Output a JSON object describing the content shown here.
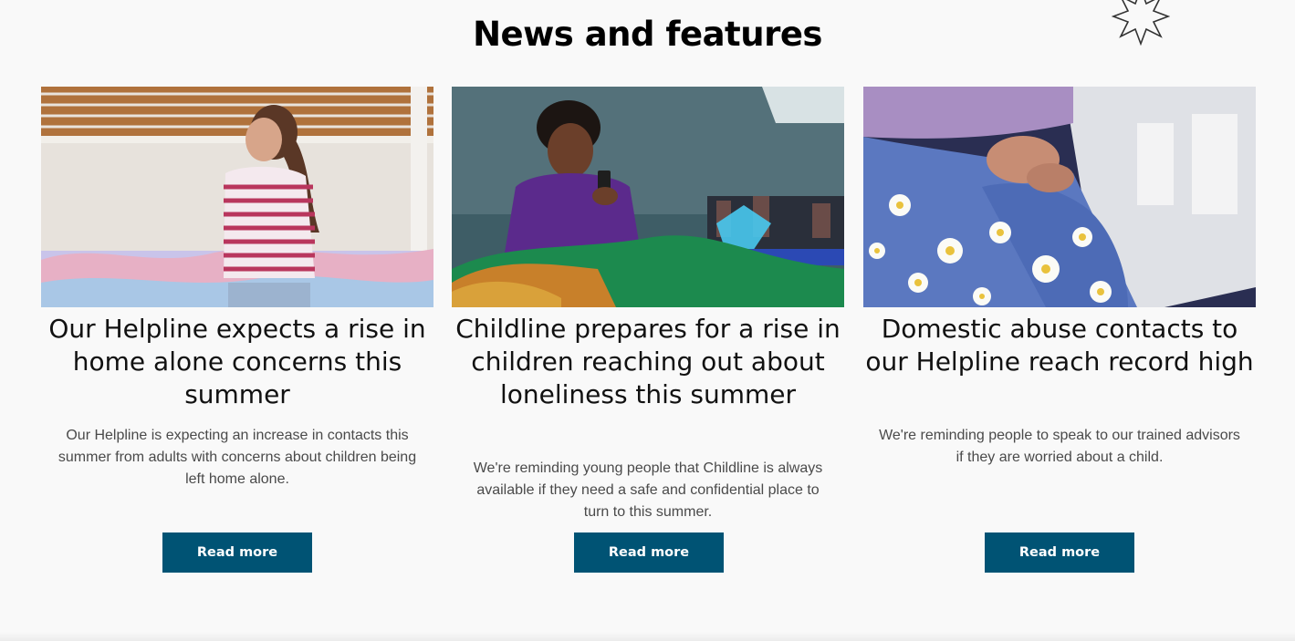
{
  "section": {
    "title": "News and features"
  },
  "cards": [
    {
      "title": "Our Helpline expects a rise in home alone concerns this summer",
      "description": "Our Helpline is expecting an increase in contacts this summer from adults with concerns about children being left home alone.",
      "button_label": "Read more"
    },
    {
      "title": "Childline prepares for a rise in children reaching out about loneliness this summer",
      "description": "We're reminding young people that Childline is always available if they need a safe and confidential place to turn to this summer.",
      "button_label": "Read more"
    },
    {
      "title": "Domestic abuse contacts to our Helpline reach record high",
      "description": "We're reminding people to speak to our trained advisors if they are worried about a child.",
      "button_label": "Read more"
    }
  ],
  "icons": {
    "decoration": "star-outline-icon"
  },
  "colors": {
    "background": "#f9f9f9",
    "button": "#005374",
    "button_text": "#ffffff",
    "heading": "#000000",
    "body_text": "#4a4a4a"
  }
}
